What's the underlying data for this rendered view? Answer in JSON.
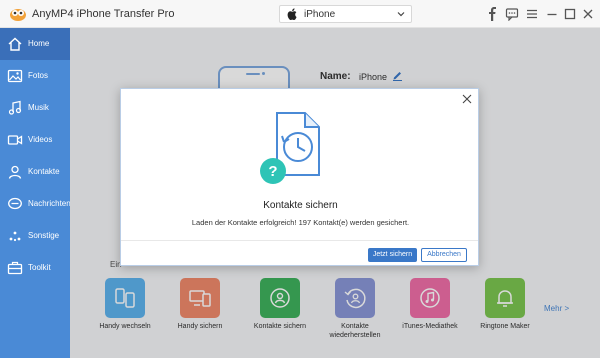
{
  "app": {
    "title": "AnyMP4 iPhone Transfer Pro"
  },
  "device_select": {
    "value": "iPhone"
  },
  "titlebar_icons": [
    "facebook-icon",
    "feedback-icon",
    "menu-icon",
    "minimize-icon",
    "maximize-icon",
    "close-icon"
  ],
  "sidebar": {
    "items": [
      {
        "label": "Home",
        "icon": "home-icon",
        "active": true
      },
      {
        "label": "Fotos",
        "icon": "photo-icon"
      },
      {
        "label": "Musik",
        "icon": "music-icon"
      },
      {
        "label": "Videos",
        "icon": "video-icon"
      },
      {
        "label": "Kontakte",
        "icon": "contacts-icon"
      },
      {
        "label": "Nachrichten",
        "icon": "message-icon"
      },
      {
        "label": "Sonstige",
        "icon": "other-icon"
      },
      {
        "label": "Toolkit",
        "icon": "toolkit-icon"
      }
    ]
  },
  "device_info": {
    "name_label": "Name:",
    "name_value": "iPhone"
  },
  "toolkit": {
    "section_label": "Ein",
    "more": "Mehr >",
    "tools": [
      {
        "label": "Handy wechseln",
        "color": "#5db3ee"
      },
      {
        "label": "Handy sichern",
        "color": "#f08a6c"
      },
      {
        "label": "Kontakte sichern",
        "color": "#3fb25d"
      },
      {
        "label": "Kontakte wiederherstellen",
        "color": "#8a97d8"
      },
      {
        "label": "iTunes-Mediathek",
        "color": "#f06fa8"
      },
      {
        "label": "Ringtone Maker",
        "color": "#7cc651"
      }
    ]
  },
  "dialog": {
    "title": "Kontakte sichern",
    "message": "Laden der Kontakte erfolgreich! 197 Kontakt(e) werden gesichert.",
    "primary_button": "Jetzt sichern",
    "secondary_button": "Abbrechen"
  },
  "colors": {
    "sidebar": "#4a8ad6",
    "sidebar_active": "#3a6fb9",
    "accent": "#3a78c8",
    "teal": "#2ec4b6"
  }
}
